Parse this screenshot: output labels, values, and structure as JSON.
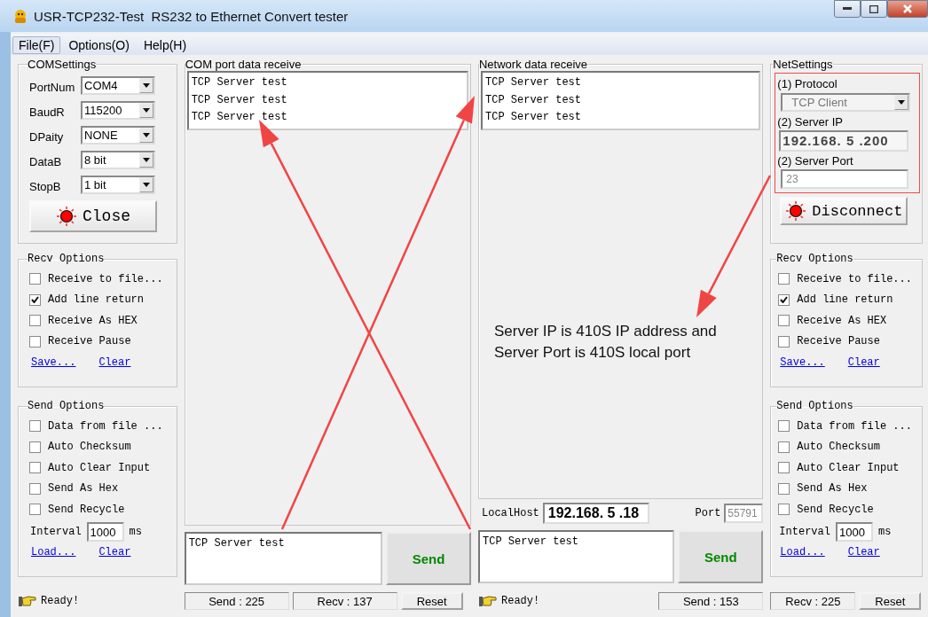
{
  "window": {
    "title": "USR-TCP232-Test  RS232 to Ethernet Convert tester"
  },
  "menu": [
    {
      "label": "File(F)",
      "selected": true
    },
    {
      "label": "Options(O)",
      "selected": false
    },
    {
      "label": "Help(H)",
      "selected": false
    }
  ],
  "com_settings": {
    "title": "COMSettings",
    "fields": [
      {
        "label": "PortNum",
        "value": "COM4"
      },
      {
        "label": "BaudR",
        "value": "115200"
      },
      {
        "label": "DPaity",
        "value": "NONE"
      },
      {
        "label": "DataB",
        "value": "8 bit"
      },
      {
        "label": "StopB",
        "value": "1 bit"
      }
    ],
    "button": "Close"
  },
  "com_receive": {
    "title": "COM port data receive",
    "lines": [
      "TCP Server test",
      "TCP Server test",
      "TCP Server test"
    ]
  },
  "network_receive": {
    "title": "Network data receive",
    "lines": [
      "TCP Server test",
      "TCP Server test",
      "TCP Server test"
    ]
  },
  "local_host": {
    "label": "LocalHost",
    "ip": "192.168. 5 .18",
    "port_label": "Port",
    "port": "55791"
  },
  "net_settings": {
    "title": "NetSettings",
    "protocol_label": "(1) Protocol",
    "protocol": "TCP Client",
    "server_ip_label": "(2) Server IP",
    "server_ip": "192.168. 5 .200",
    "server_port_label": "(2) Server Port",
    "server_port": "23",
    "button": "Disconnect"
  },
  "left_panel": {
    "recv_options": {
      "title": "Recv Options",
      "options": [
        {
          "label": "Receive to file...",
          "checked": false
        },
        {
          "label": "Add line return",
          "checked": true
        },
        {
          "label": "Receive As HEX",
          "checked": false
        },
        {
          "label": "Receive Pause",
          "checked": false
        }
      ],
      "links": [
        "Save...",
        "Clear"
      ]
    },
    "send_options": {
      "title": "Send Options",
      "options": [
        {
          "label": "Data from file ...",
          "checked": false
        },
        {
          "label": "Auto Checksum",
          "checked": false
        },
        {
          "label": "Auto Clear Input",
          "checked": false
        },
        {
          "label": "Send As Hex",
          "checked": false
        },
        {
          "label": "Send Recycle",
          "checked": false
        }
      ],
      "interval_label": "Interval",
      "interval": "1000",
      "unit": "ms",
      "links": [
        "Load...",
        "Clear"
      ]
    }
  },
  "right_panel": {
    "recv_options": {
      "title": "Recv Options",
      "options": [
        {
          "label": "Receive to file...",
          "checked": false
        },
        {
          "label": "Add line return",
          "checked": true
        },
        {
          "label": "Receive As HEX",
          "checked": false
        },
        {
          "label": "Receive Pause",
          "checked": false
        }
      ],
      "links": [
        "Save...",
        "Clear"
      ]
    },
    "send_options": {
      "title": "Send Options",
      "options": [
        {
          "label": "Data from file ...",
          "checked": false
        },
        {
          "label": "Auto Checksum",
          "checked": false
        },
        {
          "label": "Auto Clear Input",
          "checked": false
        },
        {
          "label": "Send As Hex",
          "checked": false
        },
        {
          "label": "Send Recycle",
          "checked": false
        }
      ],
      "interval_label": "Interval",
      "interval": "1000",
      "unit": "ms",
      "links": [
        "Load...",
        "Clear"
      ]
    }
  },
  "com_send": {
    "text": "TCP Server test",
    "button": "Send"
  },
  "net_send": {
    "text": "TCP Server test",
    "button": "Send"
  },
  "status_left": {
    "message": "Ready!",
    "send": "Send : 225",
    "recv": "Recv : 137",
    "reset": "Reset"
  },
  "status_right": {
    "message": "Ready!",
    "send": "Send : 153",
    "recv": "Recv : 225",
    "reset": "Reset"
  },
  "annotation": {
    "text": "Server IP is 410S IP address and\nServer Port is 410S local port"
  }
}
